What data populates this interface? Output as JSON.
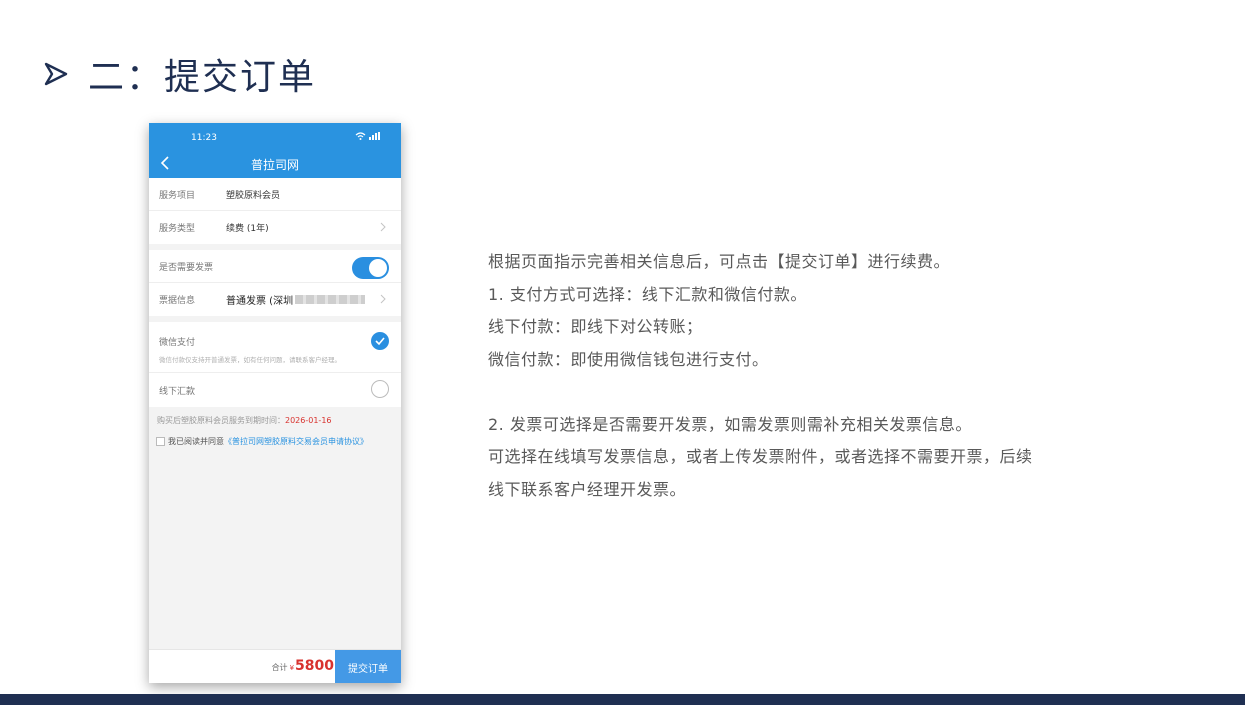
{
  "title": "二：提交订单",
  "phone": {
    "status_time": "11:23",
    "nav_title": "普拉司网",
    "rows": {
      "service_item_label": "服务项目",
      "service_item_value": "塑胶原料会员",
      "service_type_label": "服务类型",
      "service_type_value": "续费 (1年)",
      "invoice_need_label": "是否需要发票",
      "invoice_info_label": "票据信息",
      "invoice_info_value": "普通发票 (深圳",
      "wechat_pay_label": "微信支付",
      "wechat_pay_note": "微信付款仅支持开普通发票，如有任何问题，请联系客户经理。",
      "offline_pay_label": "线下汇款"
    },
    "expire_text": "购买后塑胶原料会员服务到期时间：",
    "expire_date": "2026-01-16",
    "agree_text": "我已阅读并同意",
    "agree_link": "《普拉司网塑胶原料交易会员申请协议》",
    "total_label": "合计",
    "currency": "¥",
    "total_amount": "5800",
    "submit_label": "提交订单"
  },
  "description": [
    "根据页面指示完善相关信息后，可点击【提交订单】进行续费。",
    "1.  支付方式可选择：线下汇款和微信付款。",
    "线下付款：即线下对公转账；",
    "微信付款：即使用微信钱包进行支付。",
    "",
    "2.  发票可选择是否需要开发票，如需发票则需补充相关发票信息。",
    "可选择在线填写发票信息，或者上传发票附件，或者选择不需要开票，后续",
    "线下联系客户经理开发票。"
  ],
  "colors": {
    "title": "#1f2f52",
    "accent": "#2a93e0",
    "price": "#d8322e",
    "band": "#1f2f52"
  }
}
